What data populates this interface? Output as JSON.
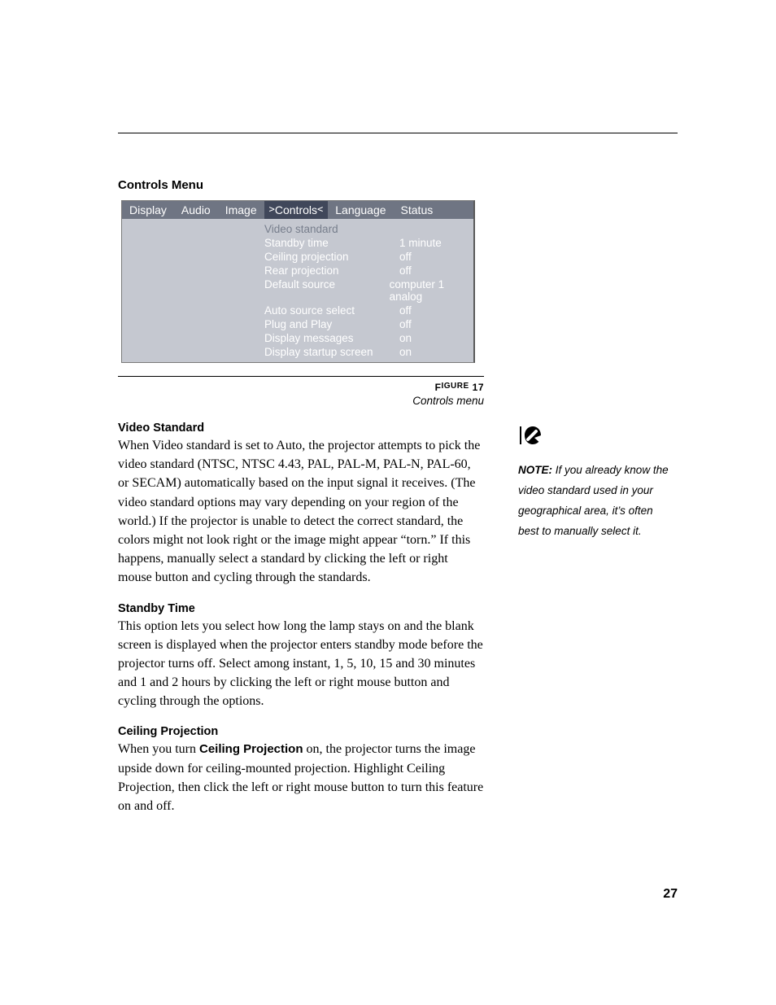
{
  "section_title": "Controls Menu",
  "menu": {
    "tabs": [
      "Display",
      "Audio",
      "Image",
      "Controls",
      "Language",
      "Status"
    ],
    "active_index": 3,
    "rows": [
      {
        "label": "Video standard",
        "value": "",
        "selected": true
      },
      {
        "label": "Standby time",
        "value": "1 minute"
      },
      {
        "label": "Ceiling projection",
        "value": "off"
      },
      {
        "label": "Rear projection",
        "value": "off"
      },
      {
        "label": "Default source",
        "value": "computer 1 analog"
      },
      {
        "label": "Auto source select",
        "value": "off"
      },
      {
        "label": "Plug and Play",
        "value": "off"
      },
      {
        "label": "Display messages",
        "value": "on"
      },
      {
        "label": "Display startup screen",
        "value": "on"
      }
    ]
  },
  "figure": {
    "label_prefix": "F",
    "label_rest": "IGURE",
    "number": "17",
    "caption": "Controls menu"
  },
  "sections": {
    "video_standard": {
      "head": "Video Standard",
      "body": "When Video standard is set to Auto, the projector attempts to pick the video standard (NTSC, NTSC 4.43, PAL, PAL-M, PAL-N, PAL-60, or SECAM) automatically based on the input signal it receives. (The video standard options may vary depending on your region of the world.) If the projector is unable to detect the correct standard, the colors might not look right or the image might appear “torn.” If this happens, manually select a standard by clicking the left or right mouse button and cycling through the standards."
    },
    "standby_time": {
      "head": "Standby Time",
      "body": "This option lets you select how long the lamp stays on and the blank screen is displayed when the projector enters standby mode before the projector turns off. Select among instant, 1, 5, 10, 15 and 30 minutes and 1 and 2 hours by clicking the left or right mouse button and cycling through the options."
    },
    "ceiling_projection": {
      "head": "Ceiling Projection",
      "body_pre": "When you turn ",
      "body_bold": "Ceiling Projection",
      "body_post": " on, the projector turns the image upside down for ceiling-mounted projection. Highlight Ceiling Projection, then click the left or right mouse button to turn this feature on and off."
    }
  },
  "note": {
    "label": "NOTE:",
    "text": " If you already know the video standard used in your geographical area, it’s often best to manually select it."
  },
  "page_number": "27"
}
